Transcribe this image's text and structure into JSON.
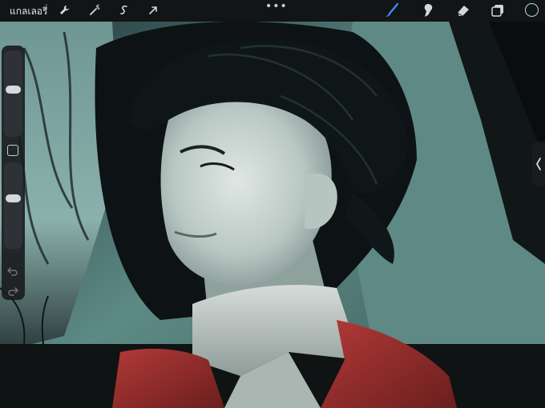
{
  "toolbar": {
    "gallery_label": "แกลเลอรี่",
    "more_label": "•••",
    "left_tools": [
      "wrench-icon",
      "magic-wand-icon",
      "selection-icon",
      "transform-icon"
    ],
    "right_tools": [
      "brush-icon",
      "smudge-icon",
      "eraser-icon",
      "layers-icon"
    ],
    "active_tool": "brush-icon",
    "active_color": "#0d1617",
    "accent_color": "#3a8bff"
  },
  "sidebar": {
    "brush_size_level": 0.55,
    "opacity_level": 0.6
  },
  "colors": {
    "toolbar_bg": "#121416",
    "panel_bg": "#1a1c1e",
    "canvas_bg_teal": "#5e8884",
    "vest_red": "#a3302f"
  }
}
